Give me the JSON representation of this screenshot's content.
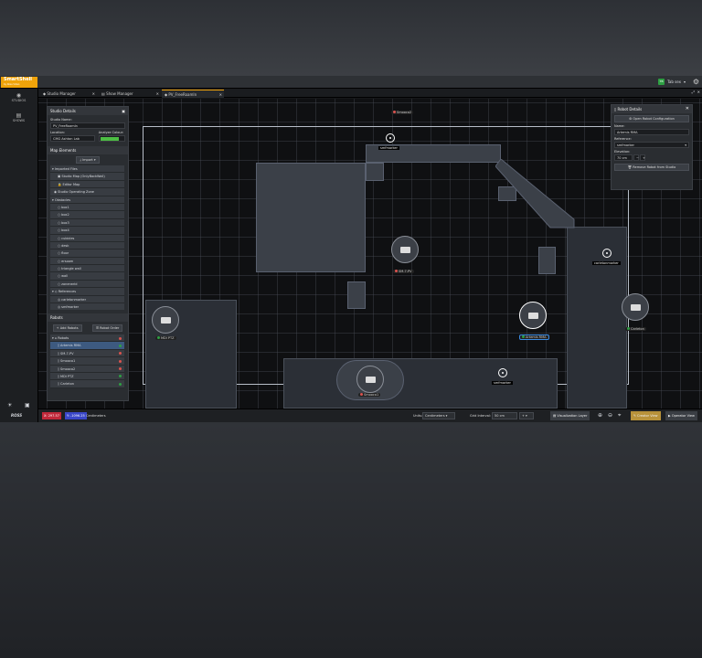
{
  "app": {
    "logo": "SmartShell",
    "logo_sub": "by Ross Video",
    "user": "Tab sex",
    "user_initials": "TB"
  },
  "nav": {
    "items": [
      {
        "label": "STUDIOS",
        "icon": "studio-icon"
      },
      {
        "label": "SHOWS",
        "icon": "shows-icon"
      }
    ],
    "brand": "ROSS"
  },
  "tabs": [
    {
      "label": "Studio Manager"
    },
    {
      "label": "Show Manager"
    },
    {
      "label": "PV_FreeRoamIn"
    }
  ],
  "studio_details": {
    "title": "Studio Details",
    "name_label": "Studio Name:",
    "name_value": "PV_FreeRoamIn",
    "location_label": "Location:",
    "location_value": "CMG Ashton Lab",
    "color_label": "Analyze Colour:",
    "color_value": "#4dbd44"
  },
  "map_elements": {
    "title": "Map Elements",
    "import_label": "Import",
    "rows": [
      "Imported Files",
      "Studio Map (OnlyBackWall)",
      "Editor Map",
      "Studio Operating Zone",
      "Obstacles",
      "box1",
      "box2",
      "box3",
      "box4",
      "cubicles",
      "desk",
      "floor",
      "ersoom",
      "triangle wall",
      "wall",
      "zonerwrid",
      "References",
      "carletonmarker",
      "smfmarker"
    ]
  },
  "robots_panel": {
    "title": "Robots",
    "add_label": "Add Robots",
    "order_label": "Robot Order",
    "rows": [
      {
        "name": "Robots",
        "status": "#d9534f"
      },
      {
        "name": "Artemis RMA",
        "status": "#2ea043"
      },
      {
        "name": "SM-7-PV",
        "status": "#d9534f"
      },
      {
        "name": "Smooco1",
        "status": "#d9534f"
      },
      {
        "name": "Smooco2",
        "status": "#d9534f"
      },
      {
        "name": "MDI PTZ",
        "status": "#2ea043"
      },
      {
        "name": "Carleton",
        "status": "#2ea043"
      }
    ]
  },
  "robot_details": {
    "title": "Robot Details",
    "open_config": "Open Robot Configuration",
    "name_label": "Name:",
    "name_value": "Artemis RMA",
    "reference_label": "Reference:",
    "reference_value": "smfmarker",
    "elevation_label": "Elevation:",
    "elevation_value": "70 cm",
    "remove_label": "Remove Robot from Studio"
  },
  "map": {
    "robots": [
      {
        "label": "SM-7-PV",
        "status": "#d9534f"
      },
      {
        "label": "MDI PTZ",
        "status": "#2ea043"
      },
      {
        "label": "Artemis RMA",
        "status": "#2ea043"
      },
      {
        "label": "Carleton",
        "status": "#2ea043"
      },
      {
        "label": "Smooco1",
        "status": "#d9534f"
      },
      {
        "label": "Smooco2",
        "status": "#d9534f"
      }
    ],
    "markers": [
      {
        "label": "smfmarker"
      },
      {
        "label": "carletonmarker"
      },
      {
        "label": "smfmarker"
      }
    ]
  },
  "statusbar": {
    "x": "X: 297.57",
    "y": "Y: -1096.25",
    "units_left": "Centimeters",
    "units_label": "Units:",
    "units_value": "Centimeters",
    "grid_label": "Grid Interval:",
    "grid_value": "50 cm",
    "layers_label": "Visualization Layer",
    "creator_label": "Creator View",
    "operator_label": "Operator View"
  }
}
